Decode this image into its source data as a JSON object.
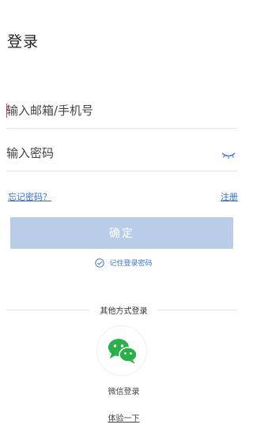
{
  "header": {
    "title": "登录"
  },
  "form": {
    "account_placeholder": "输入邮箱/手机号",
    "account_value": "",
    "password_placeholder": "输入密码",
    "password_value": "",
    "forgot_label": "忘记密码？",
    "register_label": "注册",
    "confirm_label": "确定",
    "remember_label": "记住登录密码",
    "remember_checked": true
  },
  "other_login": {
    "section_label": "其他方式登录",
    "wechat_label": "微信登录",
    "wechat_icon": "wechat-icon"
  },
  "trial": {
    "label": "体验一下"
  },
  "colors": {
    "accent_link": "#2f6fd1",
    "confirm_disabled": "#b9cde8",
    "wechat_green": "#2ab04b",
    "caret": "#d2376a"
  }
}
